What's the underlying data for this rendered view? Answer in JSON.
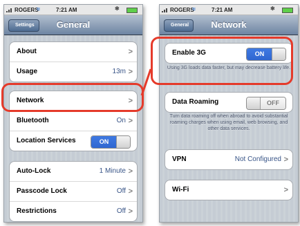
{
  "colors": {
    "accent_on": "#2f66d0",
    "callout": "#e53a2a",
    "nav": "#6d84a2"
  },
  "left": {
    "status": {
      "carrier": "ROGERS",
      "time": "7:21 AM"
    },
    "nav": {
      "back": "Settings",
      "title": "General"
    },
    "groups": [
      {
        "rows": [
          {
            "label": "About",
            "value": "",
            "chevron": ">"
          },
          {
            "label": "Usage",
            "value": "13m",
            "chevron": ">"
          }
        ]
      },
      {
        "rows": [
          {
            "label": "Network",
            "value": "",
            "chevron": ">"
          },
          {
            "label": "Bluetooth",
            "value": "On",
            "chevron": ">"
          },
          {
            "label": "Location Services",
            "toggle": "ON"
          }
        ]
      },
      {
        "rows": [
          {
            "label": "Auto-Lock",
            "value": "1 Minute",
            "chevron": ">"
          },
          {
            "label": "Passcode Lock",
            "value": "Off",
            "chevron": ">"
          },
          {
            "label": "Restrictions",
            "value": "Off",
            "chevron": ">"
          }
        ]
      }
    ]
  },
  "right": {
    "status": {
      "carrier": "ROGERS",
      "time": "7:21 AM"
    },
    "nav": {
      "back": "General",
      "title": "Network"
    },
    "enable3g": {
      "label": "Enable 3G",
      "toggle": "ON",
      "note": "Using 3G loads data faster, but may decrease battery life."
    },
    "roaming": {
      "label": "Data Roaming",
      "toggle": "OFF",
      "note": "Turn data roaming off when abroad to avoid substantial roaming charges when using email, web browsing, and other data services."
    },
    "vpn": {
      "label": "VPN",
      "value": "Not Configured",
      "chevron": ">"
    },
    "wifi": {
      "label": "Wi-Fi",
      "chevron": ">"
    }
  }
}
